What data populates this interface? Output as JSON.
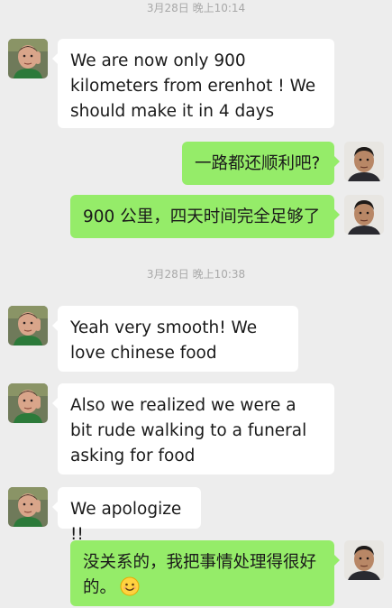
{
  "timestamps": [
    {
      "text": "3月28日 晚上10:14"
    },
    {
      "text": "3月28日 晚上10:38"
    }
  ],
  "messages": [
    {
      "sender": "contact",
      "text": "We are now only 900 kilometers from erenhot ! We should make it in 4 days"
    },
    {
      "sender": "me",
      "text": "一路都还顺利吧?"
    },
    {
      "sender": "me",
      "text": "900 公里，四天时间完全足够了"
    },
    {
      "sender": "contact",
      "text": "Yeah very smooth! We love chinese food"
    },
    {
      "sender": "contact",
      "text": "Also we realized we were a bit rude walking to a funeral asking for food"
    },
    {
      "sender": "contact",
      "text": "We apologize !!"
    },
    {
      "sender": "me",
      "text": "没关系的，我把事情处理得很好的。",
      "emoji": "smile-emoji"
    }
  ],
  "colors": {
    "background": "#ededed",
    "incoming_bubble": "#ffffff",
    "outgoing_bubble": "#95ec69",
    "timestamp_text": "#a8a8a8",
    "message_text": "#1a1a1a"
  }
}
